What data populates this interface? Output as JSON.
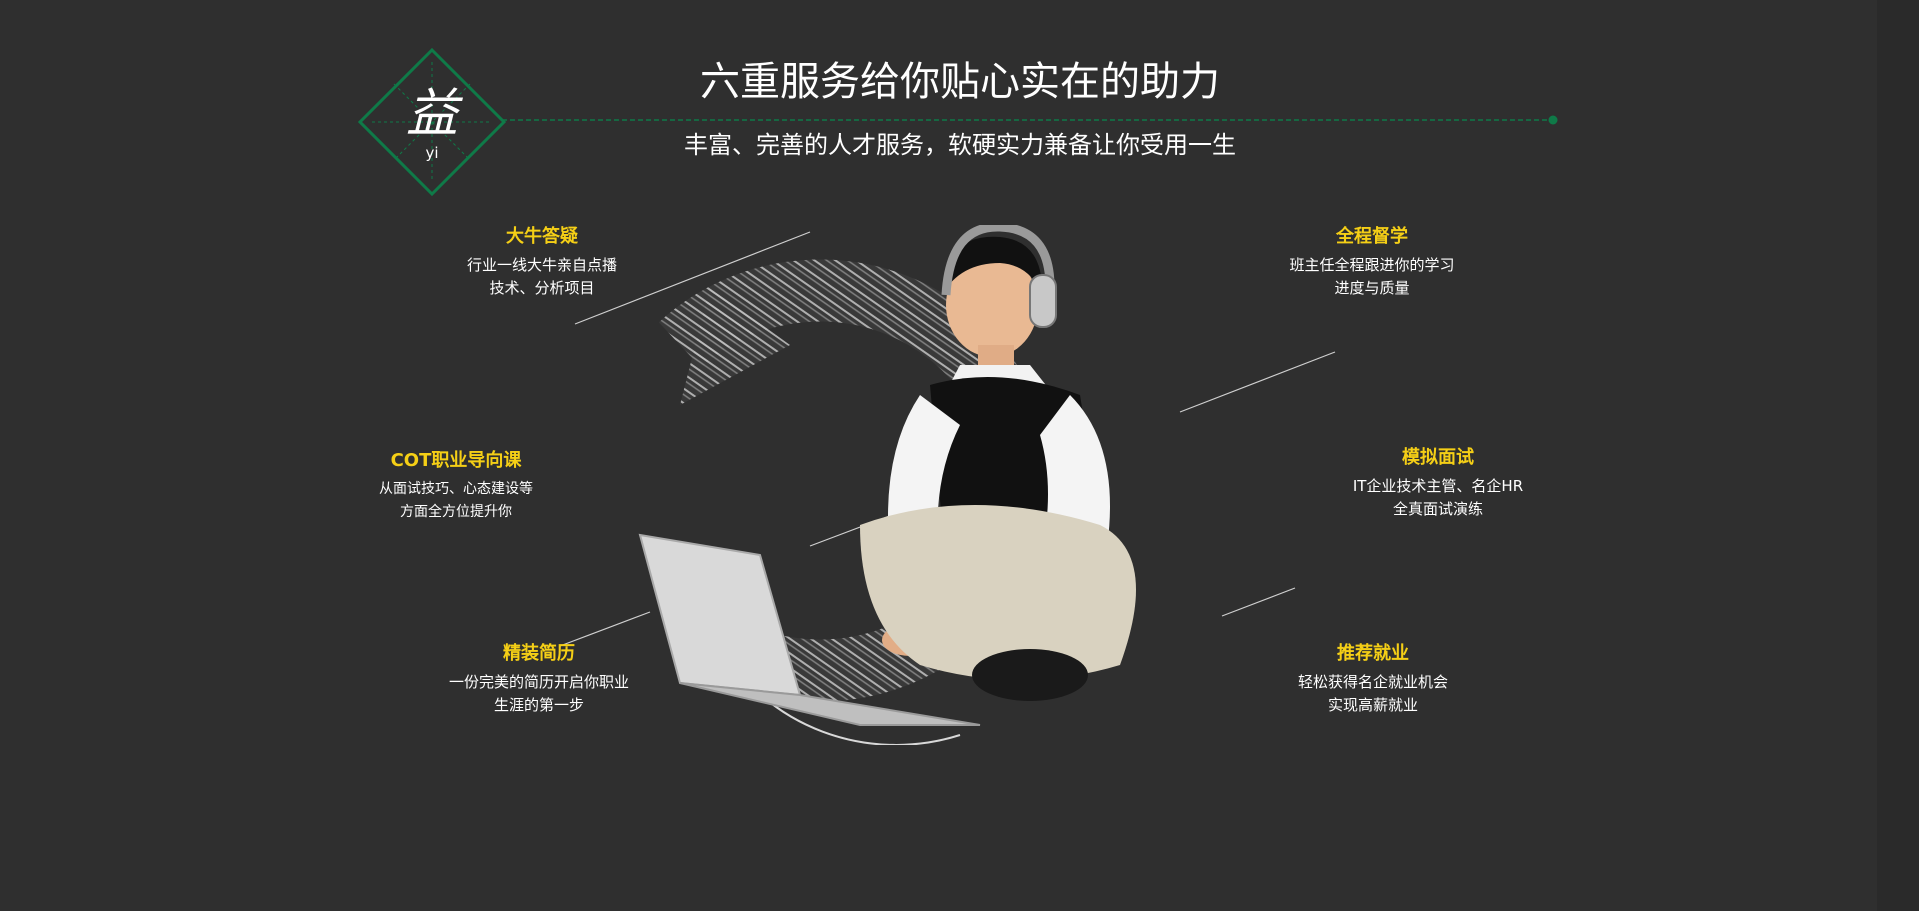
{
  "header": {
    "logo_char": "益",
    "logo_pinyin": "yi",
    "title": "六重服务给你贴心实在的助力",
    "subtitle": "丰富、完善的人才服务，软硬实力兼备让你受用一生"
  },
  "services": [
    {
      "title": "大牛答疑",
      "desc": "行业一线大牛亲自点播\n技术、分析项目"
    },
    {
      "title": "全程督学",
      "desc": "班主任全程跟进你的学习\n进度与质量"
    },
    {
      "title": "COT职业导向课",
      "desc": "从面试技巧、心态建设等\n方面全方位提升你"
    },
    {
      "title": "模拟面试",
      "desc": "IT企业技术主管、名企HR\n全真面试演练"
    },
    {
      "title": "精装简历",
      "desc": "一份完美的简历开启你职业\n生涯的第一步"
    },
    {
      "title": "推荐就业",
      "desc": "轻松获得名企就业机会\n实现高薪就业"
    }
  ],
  "colors": {
    "background": "#2f2f2f",
    "accent_green": "#0f7a48",
    "accent_yellow": "#f5cf16"
  },
  "icons": [
    "diamond-logo-icon",
    "student-with-laptop-illustration",
    "circular-arrow-decoration"
  ]
}
